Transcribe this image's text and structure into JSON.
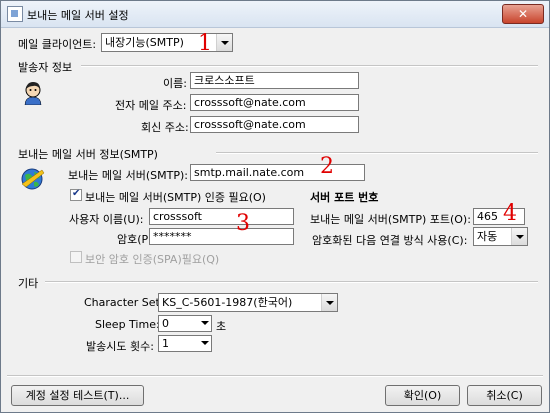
{
  "window": {
    "title": "보내는 메일 서버 설정",
    "close_glyph": "✕"
  },
  "client": {
    "label": "메일 클라이언트:",
    "selected": "내장기능(SMTP)"
  },
  "sender": {
    "group_title": "발송자 정보",
    "name_label": "이름:",
    "name_value": "크로스소프트",
    "email_label": "전자 메일 주소:",
    "email_value": "crosssoft@nate.com",
    "reply_label": "회신 주소:",
    "reply_value": "crosssoft@nate.com"
  },
  "smtp": {
    "group_title": "보내는 메일 서버 정보(SMTP)",
    "server_label": "보내는 메일 서버(SMTP):",
    "server_value": "smtp.mail.nate.com",
    "auth_label": "보내는 메일 서버(SMTP) 인증 필요(O)",
    "user_label": "사용자 이름(U):",
    "user_value": "crosssoft",
    "pass_label": "암호(P):",
    "pass_value": "*******",
    "spa_label": "보안 암호 인증(SPA)필요(Q)",
    "port_heading": "서버 포트 번호",
    "port_label": "보내는 메일 서버(SMTP) 포트(O):",
    "port_value": "465",
    "enc_label": "암호화된 다음 연결 방식 사용(C):",
    "enc_value": "자동"
  },
  "etc": {
    "group_title": "기타",
    "charset_label": "Character Set:",
    "charset_value": "KS_C-5601-1987(한국어)",
    "sleep_label": "Sleep Time:",
    "sleep_value": "0",
    "sleep_unit": "초",
    "retry_label": "발송시도 횟수:",
    "retry_value": "1"
  },
  "buttons": {
    "test": "계정 설정 테스트(T)...",
    "ok": "확인(O)",
    "cancel": "취소(C)"
  },
  "annotations": {
    "a1": "1",
    "a2": "2",
    "a3": "3",
    "a4": "4"
  },
  "colors": {
    "annotation": "#e00000"
  }
}
